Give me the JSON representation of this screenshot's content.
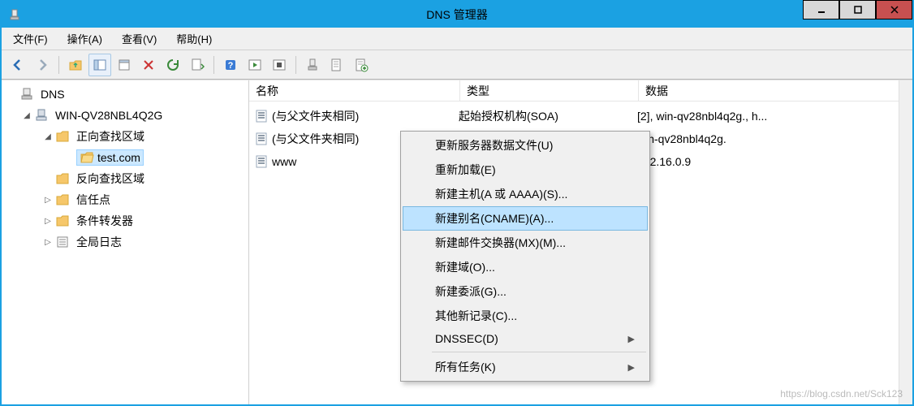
{
  "titlebar": {
    "title": "DNS 管理器"
  },
  "menubar": {
    "file": "文件(F)",
    "action": "操作(A)",
    "view": "查看(V)",
    "help": "帮助(H)"
  },
  "tree": {
    "root": "DNS",
    "server": "WIN-QV28NBL4Q2G",
    "forward_zone": "正向查找区域",
    "zone_name": "test.com",
    "reverse_zone": "反向查找区域",
    "trust_points": "信任点",
    "conditional_forwarders": "条件转发器",
    "global_logs": "全局日志"
  },
  "list": {
    "columns": {
      "name": "名称",
      "type": "类型",
      "data": "数据"
    },
    "rows": [
      {
        "name": "(与父文件夹相同)",
        "type": "起始授权机构(SOA)",
        "data": "[2], win-qv28nbl4q2g., h..."
      },
      {
        "name": "(与父文件夹相同)",
        "type": "",
        "data": "win-qv28nbl4q2g."
      },
      {
        "name": "www",
        "type": "",
        "data": "172.16.0.9"
      }
    ]
  },
  "context_menu": {
    "update_server": "更新服务器数据文件(U)",
    "reload": "重新加载(E)",
    "new_host": "新建主机(A 或 AAAA)(S)...",
    "new_cname": "新建别名(CNAME)(A)...",
    "new_mx": "新建邮件交换器(MX)(M)...",
    "new_domain": "新建域(O)...",
    "new_delegation": "新建委派(G)...",
    "other_new": "其他新记录(C)...",
    "dnssec": "DNSSEC(D)",
    "all_tasks": "所有任务(K)"
  },
  "watermark": "https://blog.csdn.net/Sck123"
}
